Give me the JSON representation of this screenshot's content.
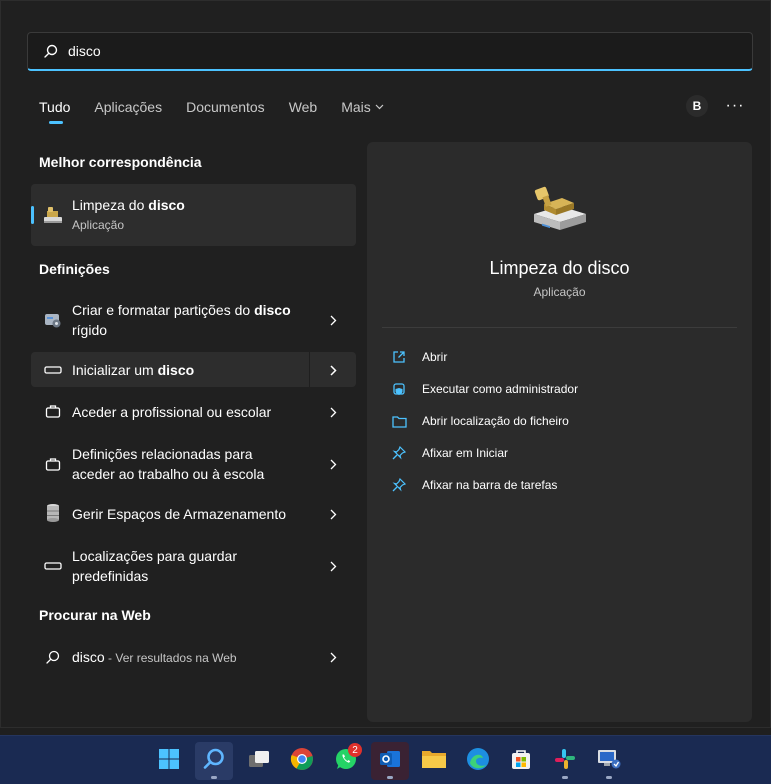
{
  "search": {
    "value": "disco"
  },
  "tabs": [
    {
      "label": "Tudo"
    },
    {
      "label": "Aplicações"
    },
    {
      "label": "Documentos"
    },
    {
      "label": "Web"
    },
    {
      "label": "Mais"
    }
  ],
  "account": {
    "initial": "B"
  },
  "more_menu": "···",
  "best_match": {
    "heading": "Melhor correspondência",
    "title_prefix": "Limpeza do ",
    "title_bold": "disco",
    "subtitle": "Aplicação"
  },
  "settings": {
    "heading": "Definições",
    "items": [
      {
        "pre": "Criar e formatar partições do ",
        "bold": "disco",
        "post": " rígido"
      },
      {
        "pre": "Inicializar um ",
        "bold": "disco",
        "post": ""
      },
      {
        "pre": "Aceder a profissional ou escolar",
        "bold": "",
        "post": ""
      },
      {
        "pre": "Definições relacionadas para aceder ao trabalho ou à escola",
        "bold": "",
        "post": ""
      },
      {
        "pre": "Gerir Espaços de Armazenamento",
        "bold": "",
        "post": ""
      },
      {
        "pre": "Localizações para guardar predefinidas",
        "bold": "",
        "post": ""
      }
    ]
  },
  "web": {
    "heading": "Procurar na Web",
    "query": "disco",
    "suffix": " - Ver resultados na Web"
  },
  "preview": {
    "title": "Limpeza do disco",
    "subtitle": "Aplicação",
    "actions": [
      {
        "label": "Abrir",
        "icon": "open-external-icon"
      },
      {
        "label": "Executar como administrador",
        "icon": "shield-admin-icon"
      },
      {
        "label": "Abrir localização do ficheiro",
        "icon": "folder-icon"
      },
      {
        "label": "Afixar em Iniciar",
        "icon": "pin-icon"
      },
      {
        "label": "Afixar na barra de tarefas",
        "icon": "pin-icon"
      }
    ]
  },
  "taskbar": {
    "whatsapp_badge": "2"
  },
  "colors": {
    "accent": "#4cc2ff",
    "panel": "#202020",
    "taskbar": "#1a2a52"
  }
}
